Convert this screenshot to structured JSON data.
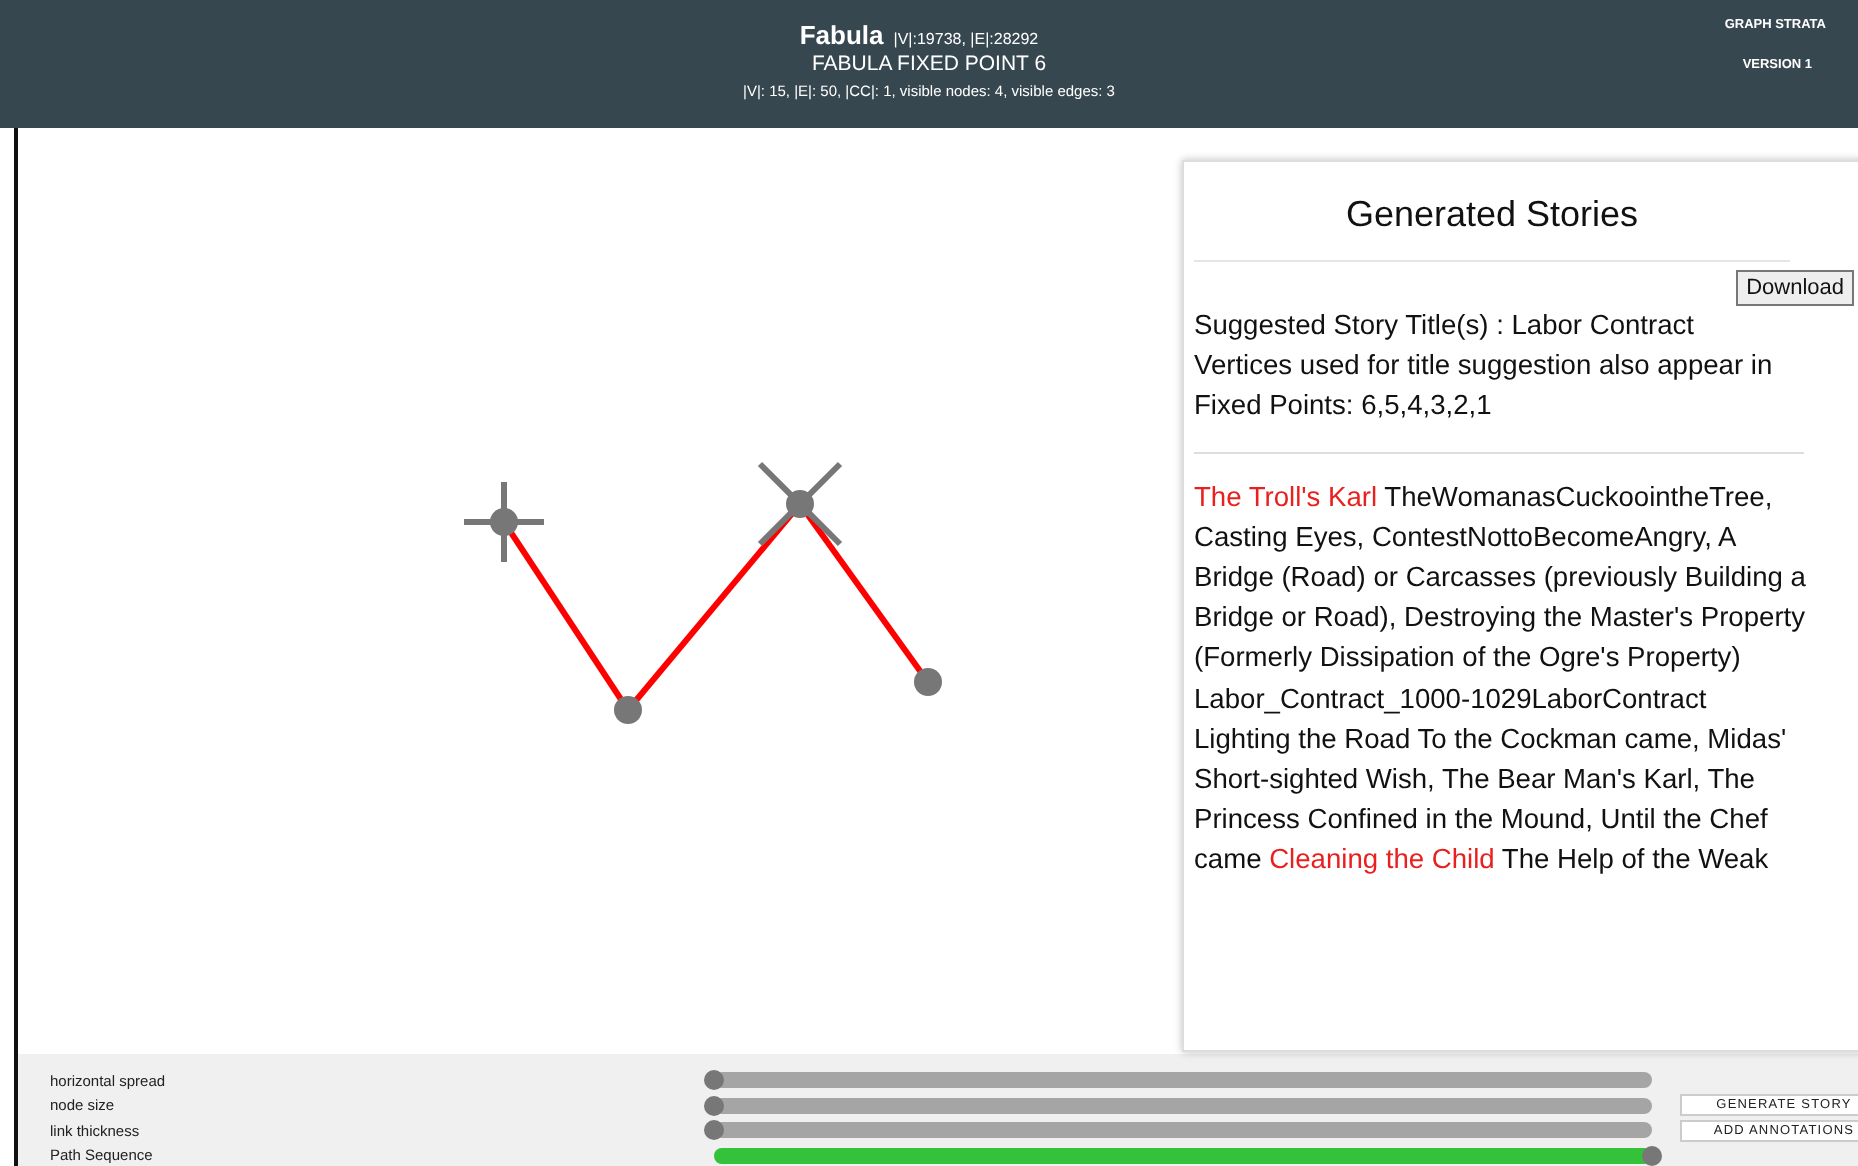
{
  "header": {
    "title": "Fabula",
    "title_stats": "|V|:19738, |E|:28292",
    "subtitle": "FABULA FIXED POINT 6",
    "stats": "|V|: 15, |E|: 50, |CC|: 1, visible nodes: 4, visible edges: 3",
    "brand": "GRAPH STRATA",
    "version": "VERSION 1"
  },
  "graph": {
    "nodes": [
      {
        "kind": "cross"
      },
      {
        "kind": "dot"
      },
      {
        "kind": "x"
      },
      {
        "kind": "dot"
      }
    ]
  },
  "stories_panel": {
    "title": "Generated Stories",
    "download": "Download",
    "suggestion": [
      "Suggested Story Title(s) : Labor Contract",
      "Vertices used for title suggestion also appear in Fixed Points: 6,5,4,3,2,1"
    ],
    "story": [
      {
        "text": "The Troll's Karl",
        "highlight": true
      },
      {
        "text": " TheWomanasCuckoointheTree, Casting Eyes, ContestNottoBecomeAngry, A Bridge (Road) or Carcasses (previously Building a Bridge or Road), Destroying the Master's Property (Formerly Dissipation of the Ogre's Property) Labor_Contract_1000-1029LaborContract Lighting the Road To the Cockman came, Midas' Short-sighted Wish, The Bear Man's Karl, The Princess Confined in the Mound, Until the Chef came ",
        "highlight": false
      },
      {
        "text": "Cleaning the Child",
        "highlight": true
      },
      {
        "text": " The Help of the Weak",
        "highlight": false
      }
    ]
  },
  "controls": {
    "sliders": [
      {
        "label": "horizontal spread",
        "level": 0,
        "kind": "plain"
      },
      {
        "label": "node size",
        "level": 0,
        "kind": "plain"
      },
      {
        "label": "link thickness",
        "level": 0,
        "kind": "plain"
      },
      {
        "label": "Path Sequence",
        "level": 1,
        "kind": "progress"
      }
    ],
    "buttons": [
      "GENERATE STORY",
      "ADD ANNOTATIONS"
    ]
  }
}
